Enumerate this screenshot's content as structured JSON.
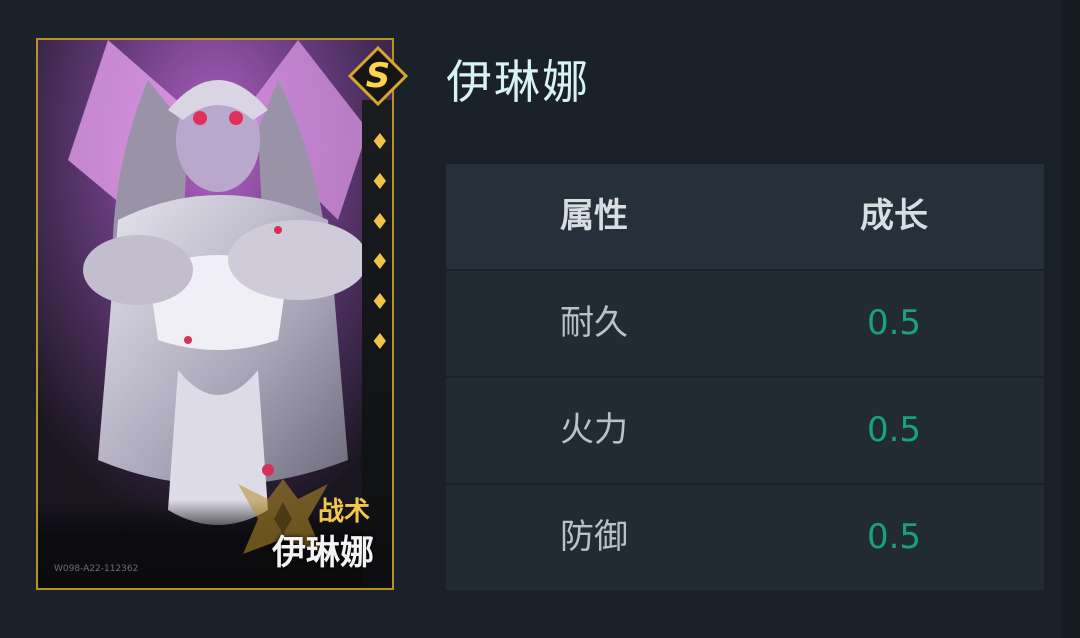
{
  "card": {
    "rank": "S",
    "stars": 6,
    "class_label": "战术",
    "name_label": "伊琳娜",
    "footnote": "W098-A22-112362"
  },
  "title": "伊琳娜",
  "table": {
    "headers": [
      "属性",
      "成长"
    ],
    "rows": [
      {
        "name": "耐久",
        "value": "0.5"
      },
      {
        "name": "火力",
        "value": "0.5"
      },
      {
        "name": "防御",
        "value": "0.5"
      }
    ]
  },
  "colors": {
    "accent_gold": "#f2c74e",
    "growth_value": "#18a37b",
    "title": "#d8f3f7",
    "background": "#1b2128"
  }
}
